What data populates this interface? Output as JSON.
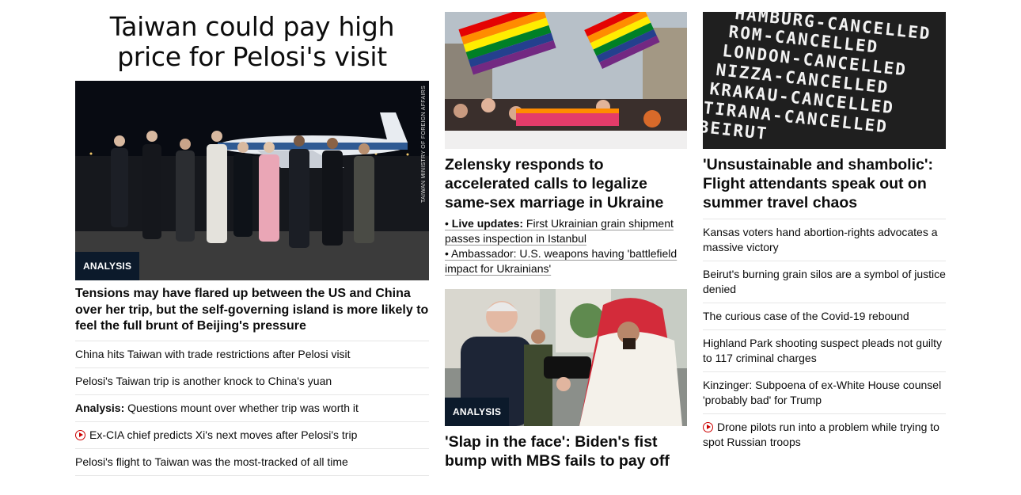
{
  "column1": {
    "title_line1": "Taiwan could pay high",
    "title_line2": "price for Pelosi's visit",
    "hero_badge": "ANALYSIS",
    "hero_credit": "TAIWAN MINISTRY OF FOREIGN AFFAIRS",
    "lead": "Tensions may have flared up between the US and China over her trip, but the self-governing island is more likely to feel the full brunt of Beijing's pressure",
    "items": [
      {
        "prefix": "",
        "text": "China hits Taiwan with trade restrictions after Pelosi visit",
        "video": false
      },
      {
        "prefix": "",
        "text": "Pelosi's Taiwan trip is another knock to China's yuan",
        "video": false
      },
      {
        "prefix": "Analysis:",
        "text": " Questions mount over whether trip was worth it",
        "video": false
      },
      {
        "prefix": "",
        "text": "Ex-CIA chief predicts Xi's next moves after Pelosi's trip",
        "video": true
      },
      {
        "prefix": "",
        "text": "Pelosi's flight to Taiwan was the most-tracked of all time",
        "video": false
      }
    ]
  },
  "column2": {
    "headline1": "Zelensky responds to accelerated calls to legalize same-sex marriage in Ukraine",
    "bullet1_bold": "Live updates:",
    "bullet1_text": " First Ukrainian grain shipment passes inspection in Istanbul",
    "bullet2_text": "Ambassador: U.S. weapons having 'battlefield impact for Ukrainians'",
    "bullet_symbol": "•",
    "image2_badge": "ANALYSIS",
    "headline2": "'Slap in the face': Biden's fist bump with MBS fails to pay off"
  },
  "column3": {
    "board_lines": [
      "HAMBURG-CANCELLED",
      "ROM-CANCELLED",
      "LONDON-CANCELLED",
      "NIZZA-CANCELLED",
      "KRAKAU-CANCELLED",
      "TIRANA-CANCELLED",
      "BEIRUT"
    ],
    "headline": "'Unsustainable and shambolic': Flight attendants speak out on summer travel chaos",
    "items": [
      {
        "text": "Kansas voters hand abortion-rights advocates a massive victory",
        "video": false
      },
      {
        "text": "Beirut's burning grain silos are a symbol of justice denied",
        "video": false
      },
      {
        "text": "The curious case of the Covid-19 rebound",
        "video": false
      },
      {
        "text": "Highland Park shooting suspect pleads not guilty to 117 criminal charges",
        "video": false
      },
      {
        "text": "Kinzinger: Subpoena of ex-White House counsel 'probably bad' for Trump",
        "video": false
      },
      {
        "text": "Drone pilots run into a problem while trying to spot Russian troops",
        "video": true
      }
    ]
  },
  "colors": {
    "badge_bg": "#0c1a2b",
    "play_red": "#cc0000",
    "divider": "#e6e6e6"
  },
  "icons": {
    "video": "play-circle-icon"
  }
}
